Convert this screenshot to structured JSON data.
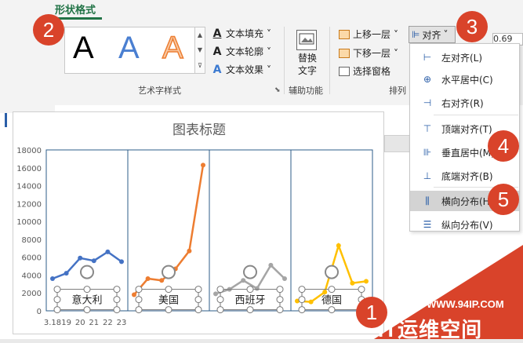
{
  "ribbon": {
    "active_tab": "形状格式",
    "wordart": {
      "letter": "A",
      "fill": "文本填充",
      "outline": "文本轮廓",
      "effects": "文本效果",
      "group": "艺术字样式"
    },
    "alt_text": {
      "line1": "替换",
      "line2": "文字",
      "group": "辅助功能"
    },
    "arrange": {
      "bring_forward": "上移一层",
      "send_backward": "下移一层",
      "selection_pane": "选择窗格",
      "group": "排列",
      "align_btn": "对齐"
    },
    "size_value": "0.69"
  },
  "align_menu": [
    "左对齐(L)",
    "水平居中(C)",
    "右对齐(R)",
    "顶端对齐(T)",
    "垂直居中(M)",
    "底端对齐(B)",
    "横向分布(H)",
    "纵向分布(V)"
  ],
  "badges": [
    "1",
    "2",
    "3",
    "4",
    "5"
  ],
  "watermark": {
    "url": "WWW.94IP.COM",
    "brand": "IT运维空间"
  },
  "chart_data": {
    "type": "line",
    "title": "图表标题",
    "ylim": [
      0,
      18000
    ],
    "y_ticks": [
      "0",
      "2000",
      "4000",
      "6000",
      "8000",
      "10000",
      "12000",
      "14000",
      "16000",
      "18000"
    ],
    "x_tick_labels": [
      "3.18",
      "19",
      "20",
      "21",
      "22",
      "23"
    ],
    "x": [
      "3.18",
      "19",
      "20",
      "21",
      "22",
      "23"
    ],
    "panels": [
      {
        "label": "意大利",
        "color": "#4472c4",
        "values": [
          3600,
          4200,
          5900,
          5600,
          6600,
          5500
        ]
      },
      {
        "label": "美国",
        "color": "#ed7d31",
        "values": [
          1800,
          3600,
          3400,
          4700,
          6700,
          16300
        ]
      },
      {
        "label": "西班牙",
        "color": "#a5a5a5",
        "values": [
          1900,
          2400,
          3400,
          2500,
          5100,
          3600
        ]
      },
      {
        "label": "德国",
        "color": "#ffc000",
        "values": [
          1100,
          1000,
          2100,
          7300,
          3100,
          3300
        ]
      }
    ],
    "grid": false
  }
}
